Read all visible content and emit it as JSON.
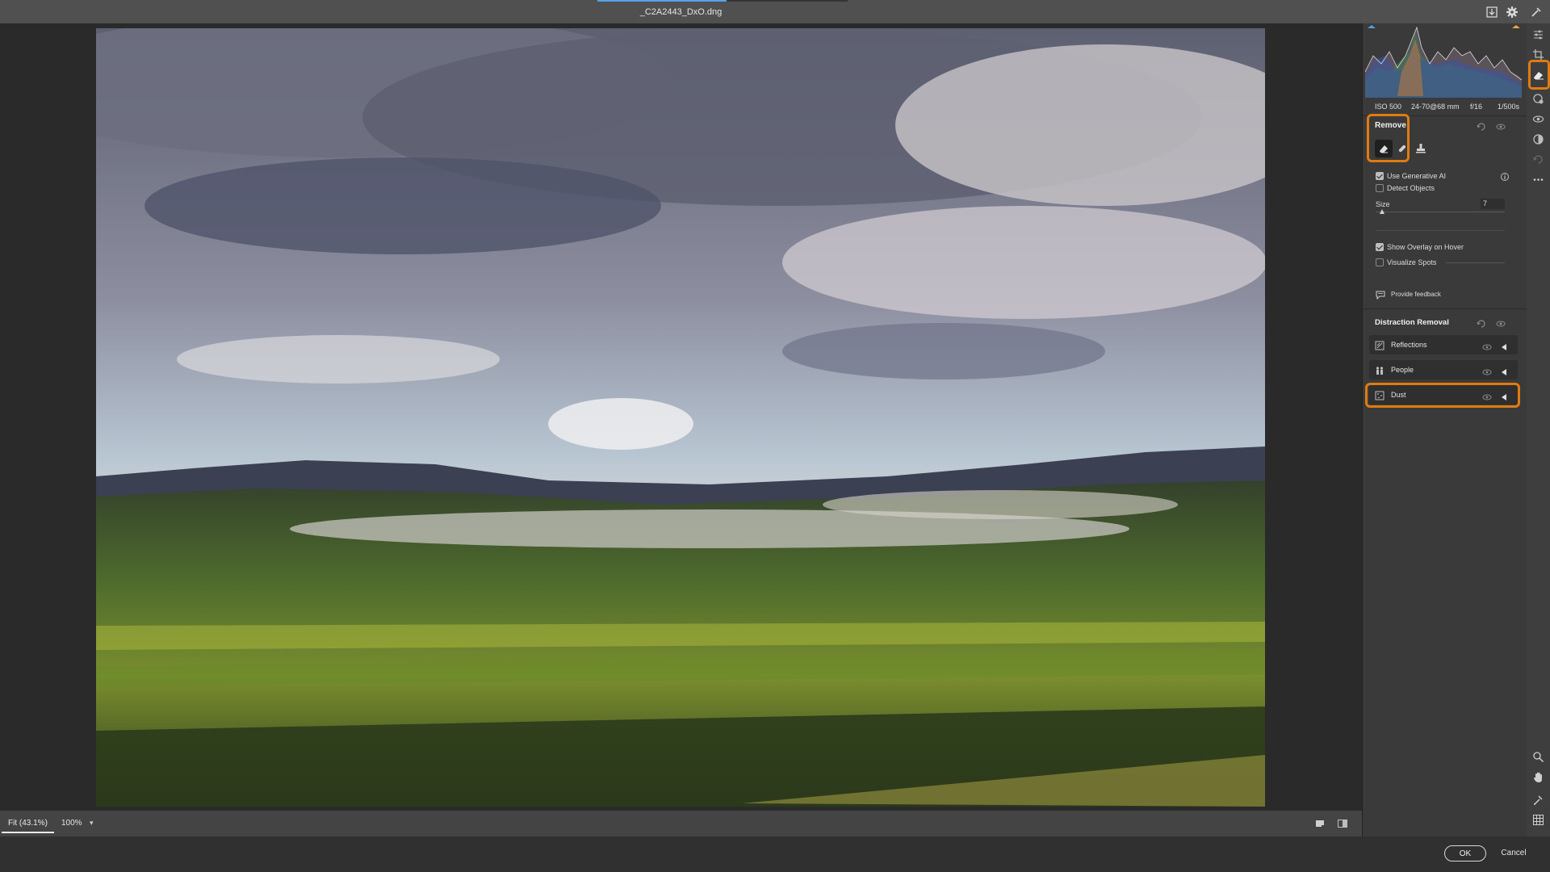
{
  "window": {
    "title": "_C2A2443_DxO.dng"
  },
  "colors": {
    "accent": "#e07b12",
    "panel": "#3a3a3a",
    "title_bar": "#505050"
  },
  "camera_info": {
    "iso": "ISO 500",
    "lens": "24-70@68 mm",
    "aperture": "f/16",
    "shutter": "1/500s"
  },
  "remove_panel": {
    "title": "Remove",
    "tools": [
      {
        "icon": "eraser-icon",
        "selected": true
      },
      {
        "icon": "healing-brush-icon",
        "selected": false
      },
      {
        "icon": "clone-stamp-icon",
        "selected": false
      }
    ],
    "use_generative_ai": {
      "label": "Use Generative AI",
      "checked": true
    },
    "detect_objects": {
      "label": "Detect Objects",
      "checked": false
    },
    "size": {
      "label": "Size",
      "value": "7"
    },
    "show_overlay": {
      "label": "Show Overlay on Hover",
      "checked": true
    },
    "visualize_spots": {
      "label": "Visualize Spots",
      "checked": false
    },
    "feedback": {
      "label": "Provide feedback",
      "icon": "feedback-icon"
    }
  },
  "distraction_removal": {
    "title": "Distraction Removal",
    "items": [
      {
        "label": "Reflections",
        "icon": "reflections-icon"
      },
      {
        "label": "People",
        "icon": "people-icon"
      },
      {
        "label": "Dust",
        "icon": "dust-icon"
      }
    ]
  },
  "status_bar": {
    "zoom_fit": "Fit (43.1%)",
    "zoom_100": "100%"
  },
  "footer": {
    "ok": "OK",
    "cancel": "Cancel"
  }
}
